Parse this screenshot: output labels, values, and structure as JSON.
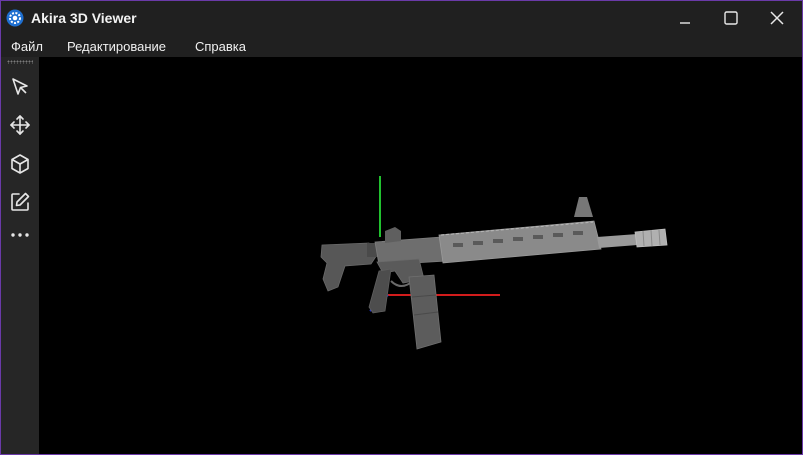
{
  "window": {
    "title": "Akira 3D Viewer",
    "app_icon": "gear-icon",
    "controls": [
      "minimize-icon",
      "maximize-icon",
      "close-icon"
    ]
  },
  "menu": {
    "items": [
      {
        "label": "Файл"
      },
      {
        "label": "Редактирование"
      },
      {
        "label": "Справка"
      }
    ]
  },
  "toolbar": {
    "tools": [
      "select-arrow-icon",
      "move-icon",
      "cube-icon",
      "edit-icon",
      "more-icon"
    ]
  },
  "viewport": {
    "background": "#000000",
    "axes": {
      "x_color": "#d21c1c",
      "y_color": "#21c12f",
      "z_color": "#2233cc"
    }
  },
  "colors": {
    "titlebar": "#202020",
    "toolbar": "#262626",
    "window_border": "#6a3aa8",
    "accent": "#2f7fd8"
  }
}
